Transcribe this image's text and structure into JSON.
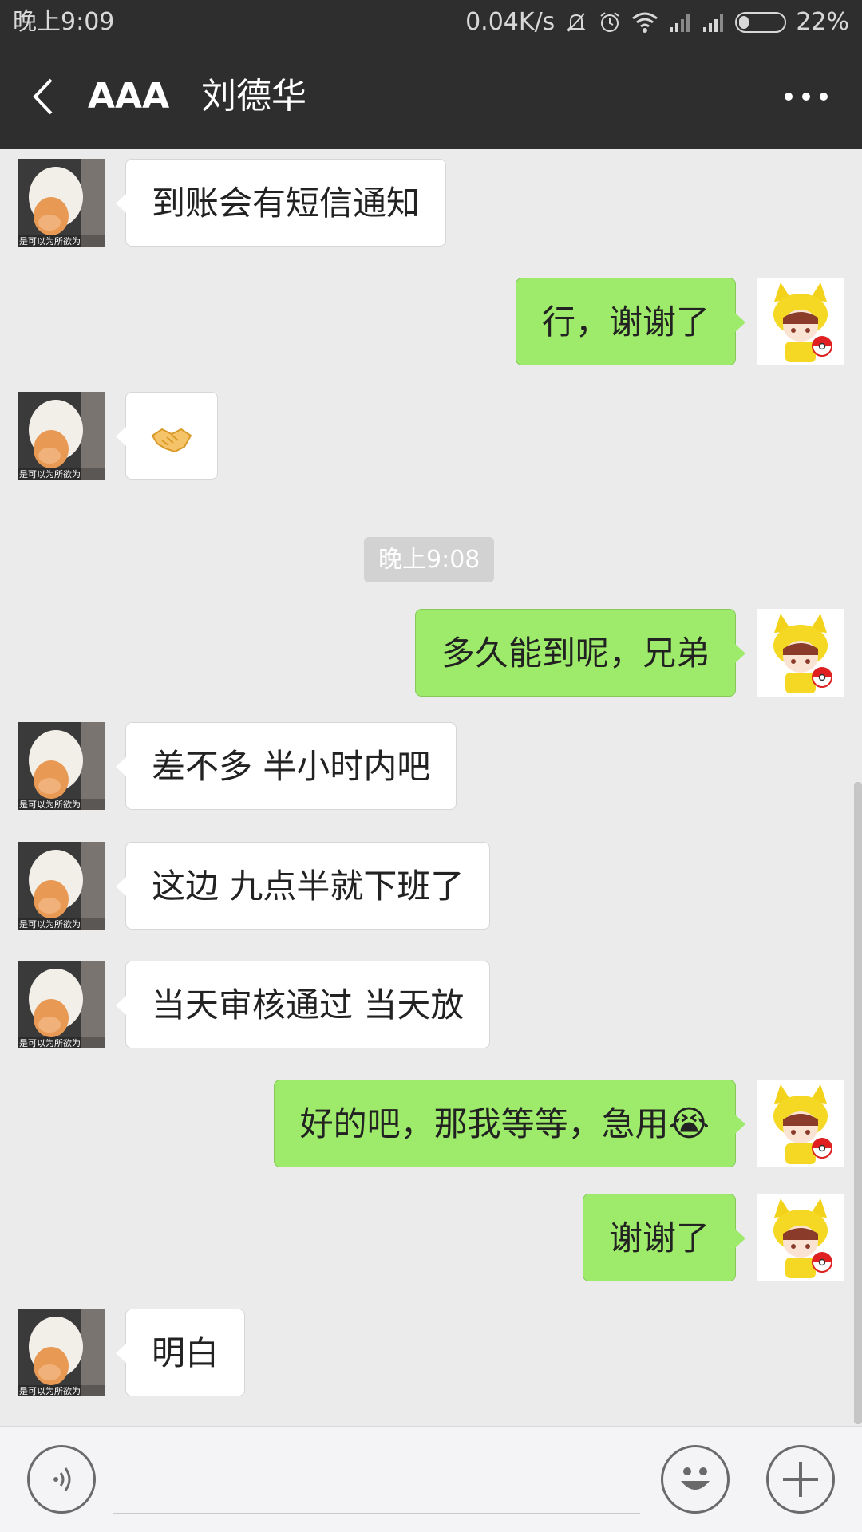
{
  "status_bar": {
    "time": "晚上9:09",
    "network_speed": "0.04K/s",
    "battery_percent": "22%",
    "battery_level": 0.22,
    "icons": [
      "mute-bell-icon",
      "alarm-icon",
      "wifi-icon",
      "signal-icon",
      "signal-icon",
      "battery-icon"
    ]
  },
  "header": {
    "title": "AAA",
    "subtitle": "刘德华",
    "back_icon": "back-chevron-icon",
    "more_icon": "more-dots-icon"
  },
  "chat": {
    "messages": [
      {
        "side": "left",
        "text": "到账会有短信通知"
      },
      {
        "side": "right",
        "text": "行，谢谢了"
      },
      {
        "side": "left",
        "text": "🤝",
        "is_emoji": true
      },
      {
        "side": "right",
        "text": "多久能到呢，兄弟"
      },
      {
        "side": "left",
        "text": "差不多 半小时内吧"
      },
      {
        "side": "left",
        "text": "这边 九点半就下班了"
      },
      {
        "side": "left",
        "text": "当天审核通过 当天放"
      },
      {
        "side": "right",
        "text": "好的吧，那我等等，急用",
        "trailing_emoji": "😭"
      },
      {
        "side": "right",
        "text": "谢谢了"
      },
      {
        "side": "left",
        "text": "明白"
      }
    ],
    "timestamp": "晚上9:08",
    "contact_avatar_caption": "是可以为所欲为",
    "colors": {
      "self_bubble": "#9eea6a",
      "other_bubble": "#ffffff",
      "background": "#ebebeb"
    }
  },
  "input_bar": {
    "voice_icon": "voice-icon",
    "emoji_icon": "smiley-icon",
    "plus_icon": "plus-icon",
    "input_value": ""
  }
}
